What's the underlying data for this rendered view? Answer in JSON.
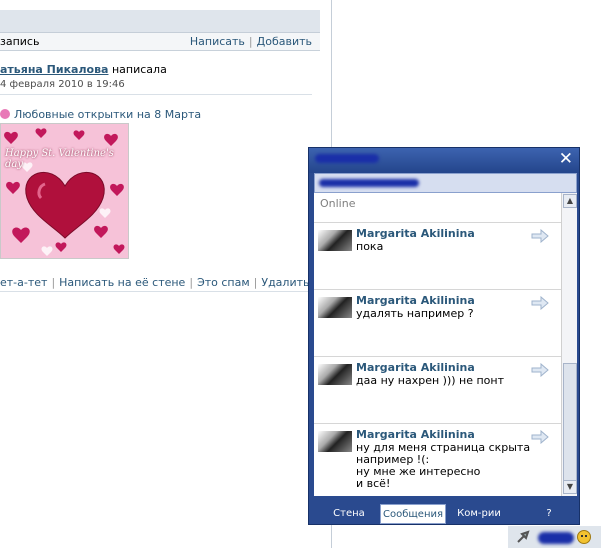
{
  "wall": {
    "header_left": "запись",
    "write_link": "Написать",
    "add_link": "Добавить",
    "author": "атьяна Пикалова",
    "action": "написала",
    "date": "4 февраля 2010 в 19:46",
    "gift_text": "Любовные открытки на 8 Марта",
    "card_title": "Happy St. Valentine's day",
    "actions": [
      "ет-а-тет",
      "Написать на её стене",
      "Это спам",
      "Удалить"
    ]
  },
  "chat": {
    "status": "Online",
    "messages": [
      {
        "name": "Margarita Akilinina",
        "text": "пока"
      },
      {
        "name": "Margarita Akilinina",
        "text": "удалять например ?"
      },
      {
        "name": "Margarita Akilinina",
        "text": "даа ну нахрен ))) не понт"
      },
      {
        "name": "Margarita Akilinina",
        "text": "ну для меня страница скрыта\nнапример !(:\nну мне же интересно\nи всё!"
      }
    ],
    "tabs": [
      "Стена",
      "Сообщения",
      "Ком-рии",
      "?"
    ],
    "active_tab": "Сообщения",
    "scroll_up": "▲",
    "scroll_down": "▼"
  },
  "colors": {
    "accent": "#2b587a",
    "chat_frame": "#2a4a8f"
  },
  "icons": [
    "close-icon",
    "arrow-right-icon",
    "heart-card-image",
    "smiley-icon",
    "tray-icon"
  ]
}
